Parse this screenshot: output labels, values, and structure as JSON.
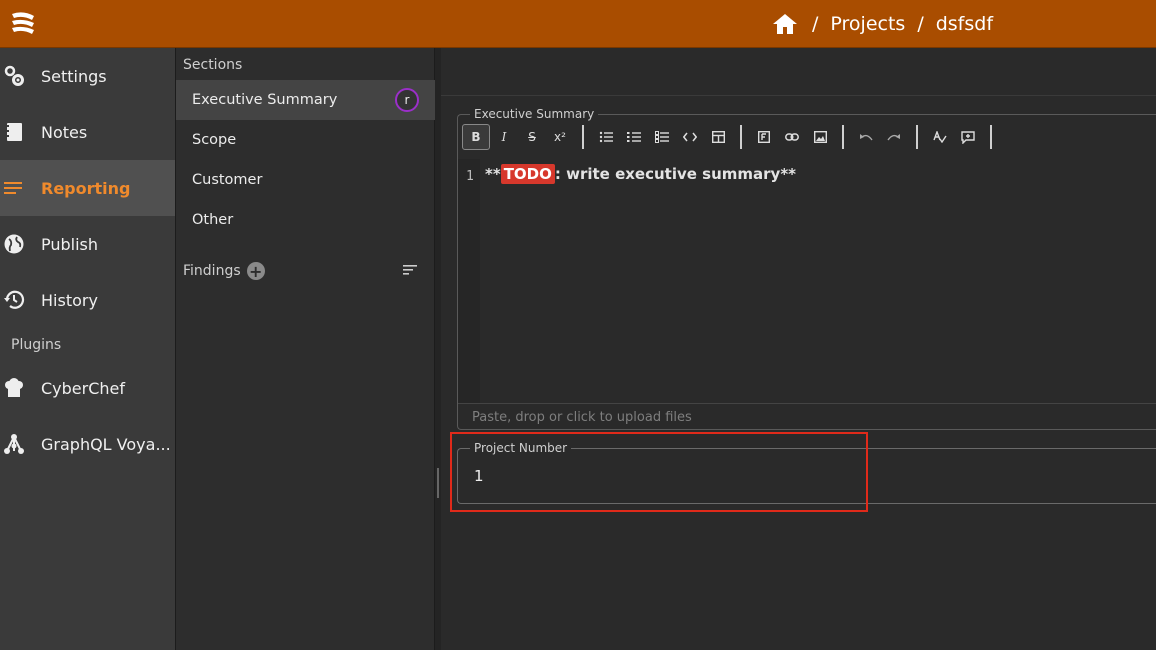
{
  "header": {
    "breadcrumb": [
      {
        "icon": "home-icon"
      },
      {
        "label": "Projects"
      },
      {
        "label": "dsfsdf"
      }
    ],
    "separator": "/"
  },
  "nav": {
    "items": [
      {
        "label": "Settings",
        "icon": "gear-icon"
      },
      {
        "label": "Notes",
        "icon": "notebook-icon"
      },
      {
        "label": "Reporting",
        "icon": "lines-icon",
        "active": true
      },
      {
        "label": "Publish",
        "icon": "globe-icon"
      },
      {
        "label": "History",
        "icon": "history-icon"
      }
    ],
    "plugins_label": "Plugins",
    "plugins": [
      {
        "label": "CyberChef",
        "icon": "chef-hat-icon"
      },
      {
        "label": "GraphQL Voya...",
        "icon": "graph-icon"
      }
    ]
  },
  "sections": {
    "header": "Sections",
    "items": [
      {
        "label": "Executive Summary",
        "active": true,
        "avatar": "r"
      },
      {
        "label": "Scope"
      },
      {
        "label": "Customer"
      },
      {
        "label": "Other"
      }
    ],
    "findings_label": "Findings",
    "add_symbol": "+"
  },
  "editor": {
    "legend": "Executive Summary",
    "toolbar": [
      "B",
      "I",
      "S",
      "x²"
    ],
    "line_number": "1",
    "content_prefix": "**",
    "content_tag": "TODO",
    "content_rest": ": write executive summary**",
    "upload_hint": "Paste, drop or click to upload files"
  },
  "project_field": {
    "legend": "Project Number",
    "value": "1"
  },
  "colors": {
    "header_bg": "#a94d00",
    "accent": "#f08a2c",
    "highlight": "#e02a1a",
    "todo_bg": "#d7382c"
  }
}
